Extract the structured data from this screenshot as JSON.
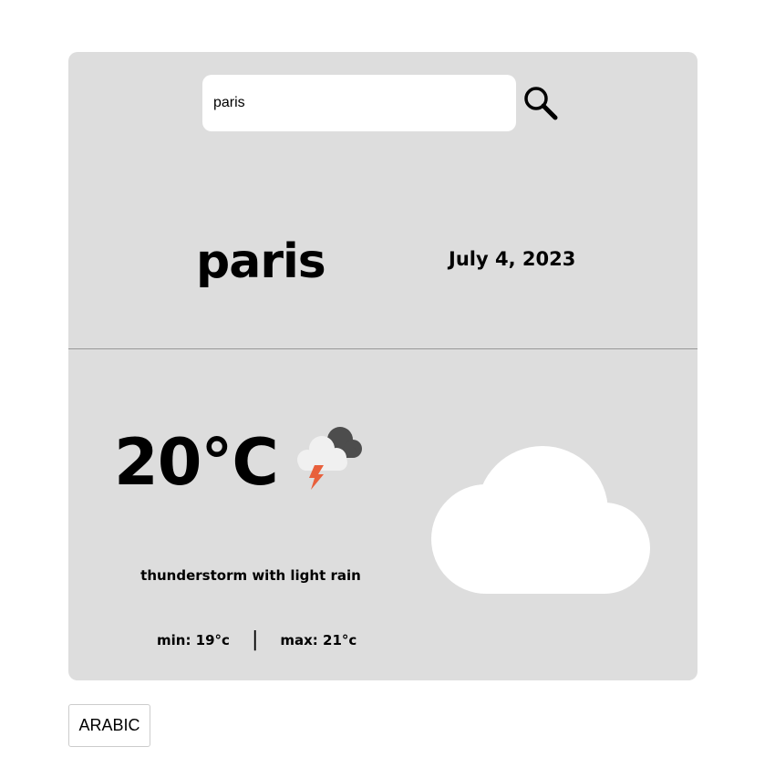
{
  "search": {
    "value": "paris",
    "icon": "search-icon"
  },
  "location": {
    "city": "paris",
    "date": "July 4, 2023"
  },
  "weather": {
    "temperature": "20°C",
    "icon": "thunderstorm-icon",
    "description": "thunderstorm with light rain",
    "min_label": "min: 19°c",
    "separator": "|",
    "max_label": "max: 21°c",
    "illustration": "cloud-icon"
  },
  "language_button": {
    "label": "ARABIC"
  },
  "colors": {
    "card_background": "#dddddd",
    "lightning": "#e8603c",
    "dark_cloud": "#555555",
    "light_cloud": "#eeeeee"
  }
}
